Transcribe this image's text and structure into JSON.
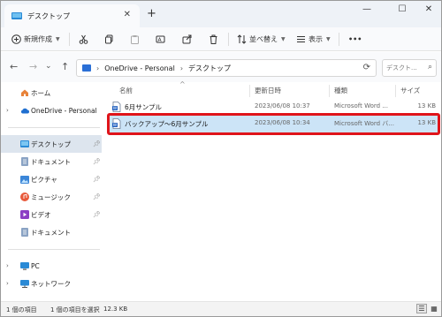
{
  "window": {
    "tab_title": "デスクトップ",
    "tab_close": "✕",
    "new_tab": "+",
    "controls": {
      "minimize": "—",
      "maximize": "☐",
      "close": "✕"
    }
  },
  "toolbar": {
    "new_label": "新規作成",
    "sort_label": "並べ替え",
    "view_label": "表示",
    "more": "•••"
  },
  "address": {
    "crumbs": [
      "OneDrive - Personal",
      "デスクトップ"
    ],
    "separator": "›",
    "search_placeholder": "デスクト..."
  },
  "sidebar": {
    "items": [
      {
        "label": "ホーム",
        "icon": "home-icon"
      },
      {
        "label": "OneDrive - Personal",
        "icon": "cloud-icon"
      },
      {
        "label": "デスクトップ",
        "icon": "desktop-icon"
      },
      {
        "label": "ドキュメント",
        "icon": "documents-icon"
      },
      {
        "label": "ピクチャ",
        "icon": "pictures-icon"
      },
      {
        "label": "ミュージック",
        "icon": "music-icon"
      },
      {
        "label": "ビデオ",
        "icon": "videos-icon"
      },
      {
        "label": "ドキュメント",
        "icon": "documents-icon"
      },
      {
        "label": "PC",
        "icon": "pc-icon"
      },
      {
        "label": "ネットワーク",
        "icon": "network-icon"
      }
    ]
  },
  "content": {
    "columns": {
      "name": "名前",
      "date": "更新日時",
      "type": "種類",
      "size": "サイズ"
    },
    "files": [
      {
        "name": "6月サンプル",
        "date": "2023/06/08 10:37",
        "type": "Microsoft Word ...",
        "size": "13 KB"
      },
      {
        "name": "バックアップ～6月サンプル",
        "date": "2023/06/08 10:34",
        "type": "Microsoft Word バ...",
        "size": "13 KB"
      }
    ]
  },
  "status": {
    "count": "1 個の項目",
    "selected": "1 個の項目を選択",
    "size": "12.3 KB"
  },
  "colors": {
    "selection": "#cce4f7",
    "highlight_border": "#e0141a",
    "accent": "#2a6fd6"
  }
}
